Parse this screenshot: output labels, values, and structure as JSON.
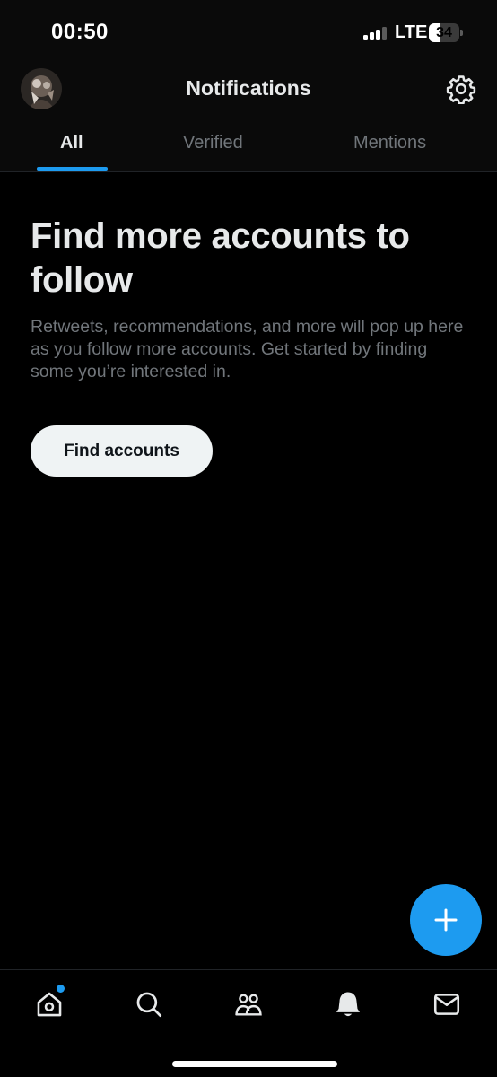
{
  "status_bar": {
    "time": "00:50",
    "network": "LTE",
    "battery_percent": "34",
    "battery_level": 0.34
  },
  "header": {
    "title": "Notifications",
    "settings_icon": "gear-icon"
  },
  "tabs": [
    {
      "label": "All",
      "active": true
    },
    {
      "label": "Verified",
      "active": false
    },
    {
      "label": "Mentions",
      "active": false
    }
  ],
  "empty_state": {
    "title": "Find more accounts to follow",
    "description": "Retweets, recommendations, and more will pop up here as you follow more accounts. Get started by finding some you’re interested in.",
    "button_label": "Find accounts"
  },
  "fab": {
    "icon": "plus-icon"
  },
  "bottom_nav": [
    {
      "icon": "home-icon",
      "has_unread_dot": true
    },
    {
      "icon": "search-icon"
    },
    {
      "icon": "communities-icon"
    },
    {
      "icon": "bell-icon",
      "active": true
    },
    {
      "icon": "mail-icon"
    }
  ],
  "colors": {
    "accent": "#1d9bf0",
    "background": "#000000",
    "text_primary": "#e7e9ea",
    "text_secondary": "#71767b",
    "button_background": "#eff3f4"
  }
}
